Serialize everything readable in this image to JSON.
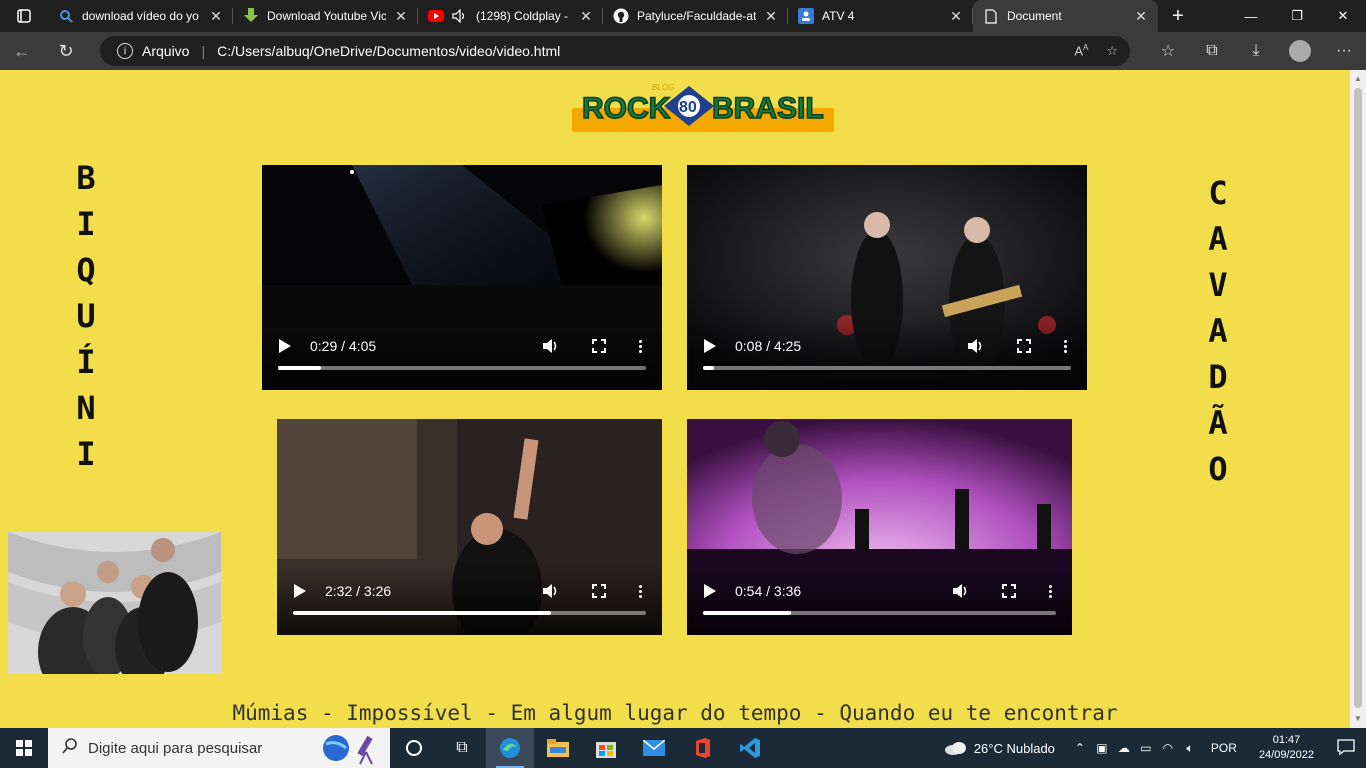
{
  "browser": {
    "tabs": [
      {
        "title": "download vídeo do yo",
        "favicon": "search-icon",
        "active": false
      },
      {
        "title": "Download Youtube Vic",
        "favicon": "download-arrow-icon",
        "active": false
      },
      {
        "title": "(1298) Coldplay -",
        "favicon": "youtube-icon",
        "active": false,
        "audio": true
      },
      {
        "title": "Patyluce/Faculdade-at",
        "favicon": "github-icon",
        "active": false
      },
      {
        "title": "ATV 4",
        "favicon": "classroom-icon",
        "active": false
      },
      {
        "title": "Document",
        "favicon": "document-icon",
        "active": true
      }
    ],
    "address": {
      "scheme_label": "Arquivo",
      "url": "C:/Users/albuq/OneDrive/Documentos/video/video.html"
    }
  },
  "page": {
    "logo": {
      "small": "BLOG",
      "word1": "ROCK",
      "number": "80",
      "word2": "BRASIL"
    },
    "left_vertical": [
      "B",
      "I",
      "Q",
      "U",
      "Í",
      "N",
      "I"
    ],
    "right_vertical": [
      "C",
      "A",
      "V",
      "A",
      "D",
      "Ã",
      "O"
    ],
    "videos": [
      {
        "time": "0:29 / 4:05",
        "progress": 0.118
      },
      {
        "time": "0:08 / 4:25",
        "progress": 0.03
      },
      {
        "time": "2:32 / 3:26",
        "progress": 0.73
      },
      {
        "time": "0:54 / 3:36",
        "progress": 0.25
      }
    ],
    "footer": "Múmias - Impossível - Em algum lugar do tempo - Quando eu te encontrar"
  },
  "taskbar": {
    "search_placeholder": "Digite aqui para pesquisar",
    "weather": "26°C  Nublado",
    "language": "POR",
    "time": "01:47",
    "date": "24/09/2022"
  },
  "colors": {
    "page_background": "#f2de4a",
    "logo_green": "#1a7a3c",
    "logo_blue": "#1f3f8f"
  }
}
